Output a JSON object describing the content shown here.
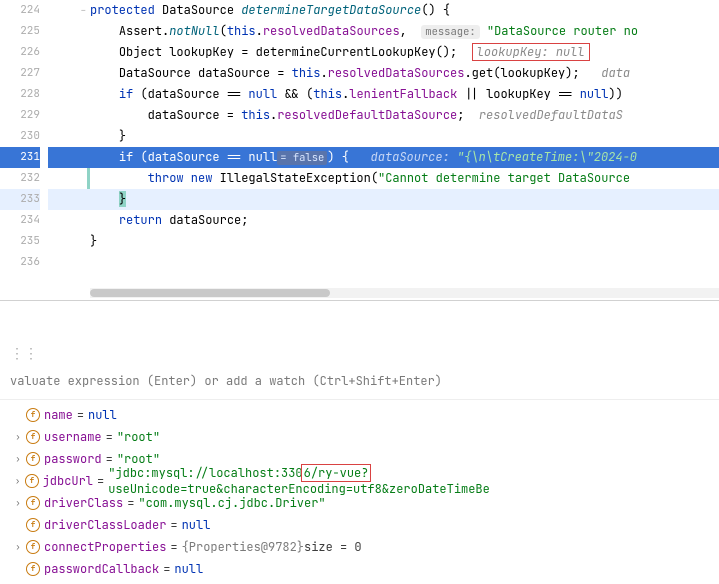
{
  "gutter": [
    "224",
    "225",
    "226",
    "227",
    "228",
    "229",
    "230",
    "231",
    "232",
    "233",
    "234",
    "235",
    "236"
  ],
  "code": {
    "l224": {
      "kw1": "protected",
      "type": "DataSource",
      "method": "determineTargetDataSource",
      "paren": "() {"
    },
    "l225": {
      "cls": "Assert",
      "dot": ".",
      "m": "notNull",
      "open": "(",
      "kw": "this",
      "dot2": ".",
      "field": "resolvedDataSources",
      "comma": ", ",
      "hintbox": "message:",
      "sp": " ",
      "str": "\"DataSource router no"
    },
    "l226": {
      "t": "Object lookupKey = determineCurrentLookupKey();",
      "hint": "lookupKey: null"
    },
    "l227": {
      "t1": "DataSource dataSource = ",
      "kw": "this",
      "dot": ".",
      "field": "resolvedDataSources",
      "t2": ".get(lookupKey);",
      "hint": "   data"
    },
    "l228": {
      "kw1": "if",
      "t1": " (dataSource == ",
      "kw2": "null",
      "t2": " && (",
      "kw3": "this",
      "dot": ".",
      "field": "lenientFallback",
      "t3": " || lookupKey == ",
      "kw4": "null",
      "t4": "))"
    },
    "l229": {
      "t1": "dataSource = ",
      "kw": "this",
      "dot": ".",
      "field": "resolvedDefaultDataSource",
      "t2": ";",
      "hint": "  resolvedDefaultDataS"
    },
    "l230": {
      "t": "}"
    },
    "l231": {
      "kw": "if",
      "t1": " (dataSource == ",
      "kw2": "null",
      "vbox": "= false",
      "t2": ") {",
      "hint1": "   dataSource: ",
      "hint2": "\"{\\n\\tCreateTime:\\\"2024-0"
    },
    "l232": {
      "kw": "throw new",
      "t": " IllegalStateException(",
      "str": "\"Cannot determine target DataSource"
    },
    "l233": {
      "t": "}"
    },
    "l234": {
      "kw": "return",
      "t": " dataSource;"
    },
    "l235": {
      "t": "}"
    }
  },
  "watch_placeholder": "valuate expression (Enter) or add a watch (Ctrl+Shift+Enter)",
  "handle": "⋮⋮",
  "vars": [
    {
      "expand": "",
      "icon": "f",
      "name": "name",
      "val_type": "null",
      "val": "null"
    },
    {
      "expand": "›",
      "icon": "f",
      "name": "username",
      "val_type": "str",
      "val": "\"root\""
    },
    {
      "expand": "›",
      "icon": "f",
      "name": "password",
      "val_type": "str",
      "val": "\"root\""
    },
    {
      "expand": "›",
      "icon": "f",
      "name": "jdbcUrl",
      "val_type": "str",
      "val_pre": "\"jdbc:mysql://localhost:330",
      "val_hl": "6/ry-vue?",
      "val_post": "useUnicode=true&characterEncoding=utf8&zeroDateTimeBe"
    },
    {
      "expand": "›",
      "icon": "f",
      "name": "driverClass",
      "val_type": "str",
      "val": "\"com.mysql.cj.jdbc.Driver\""
    },
    {
      "expand": "",
      "icon": "f",
      "name": "driverClassLoader",
      "val_type": "null",
      "val": "null"
    },
    {
      "expand": "›",
      "icon": "f",
      "name": "connectProperties",
      "val_type": "obj",
      "val": "{Properties@9782}",
      "extra": "  size = 0"
    },
    {
      "expand": "",
      "icon": "f",
      "name": "passwordCallback",
      "val_type": "null",
      "val": "null"
    }
  ]
}
